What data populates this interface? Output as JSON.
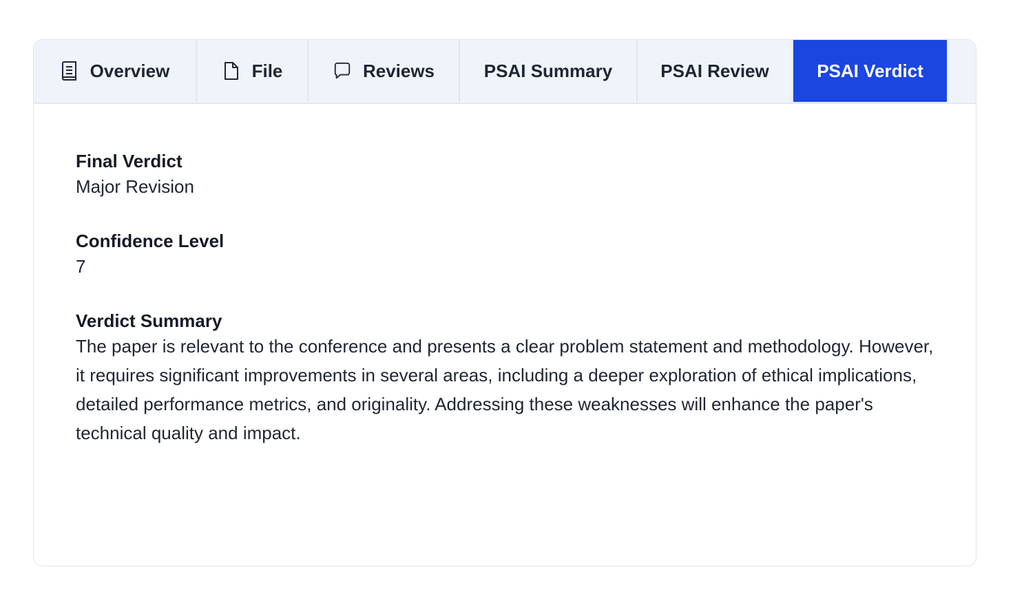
{
  "tabs": [
    {
      "label": "Overview",
      "icon": "book-icon"
    },
    {
      "label": "File",
      "icon": "file-icon"
    },
    {
      "label": "Reviews",
      "icon": "comment-icon"
    },
    {
      "label": "PSAI Summary"
    },
    {
      "label": "PSAI Review"
    },
    {
      "label": "PSAI Verdict",
      "active": true
    }
  ],
  "verdict": {
    "final_verdict_label": "Final Verdict",
    "final_verdict_value": "Major Revision",
    "confidence_label": "Confidence Level",
    "confidence_value": "7",
    "summary_label": "Verdict Summary",
    "summary_value": "The paper is relevant to the conference and presents a clear problem statement and methodology. However, it requires significant improvements in several areas, including a deeper exploration of ethical implications, detailed performance metrics, and originality. Addressing these weaknesses will enhance the paper's technical quality and impact."
  },
  "colors": {
    "active_tab": "#1c46e0",
    "tabbar_bg": "#eff3fa"
  }
}
